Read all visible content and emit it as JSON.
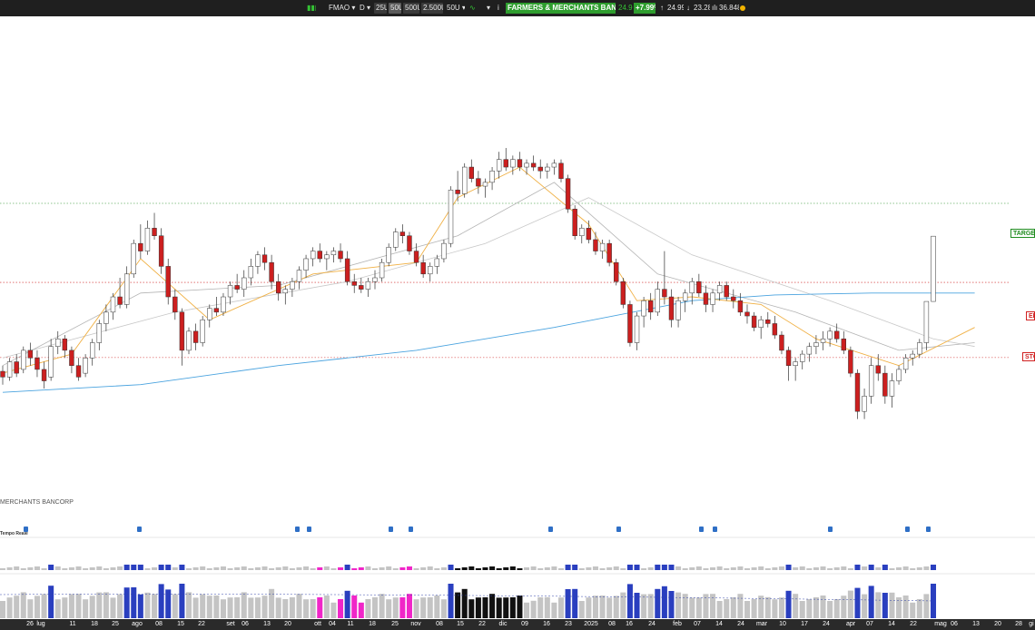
{
  "toolbar": {
    "symbol": "FMAO",
    "interval": "D",
    "chips": [
      "25U",
      "50U",
      "500U",
      "2.500U",
      "50U"
    ],
    "company": "FARMERS & MERCHANTS BANCORP",
    "last": "24.99",
    "change": "+7.99%",
    "high": "24.99",
    "low": "23.28",
    "volume": "36.848"
  },
  "levels": {
    "target": "TARGET",
    "entry": "EN",
    "stop": "STO"
  },
  "company_caption": "MERCHANTS BANCORP",
  "realtime_caption": "Tempo Reale",
  "x_labels": [
    "26",
    "lug",
    "11",
    "18",
    "25",
    "ago",
    "08",
    "15",
    "22",
    "set",
    "06",
    "13",
    "20",
    "ott",
    "04",
    "11",
    "18",
    "25",
    "nov",
    "08",
    "15",
    "22",
    "dic",
    "09",
    "16",
    "23",
    "2025",
    "08",
    "16",
    "24",
    "feb",
    "07",
    "14",
    "24",
    "mar",
    "10",
    "17",
    "24",
    "apr",
    "07",
    "14",
    "22",
    "mag",
    "06",
    "13",
    "20",
    "28",
    "gi"
  ],
  "colors": {
    "up": "#ffffff",
    "down": "#cc1f1f",
    "ma200": "#4aa3df",
    "ma_fast": "#f0b044",
    "target": "#1e8c1e",
    "stop": "#d02020",
    "vol_blue": "#2a3fbf",
    "vol_pink": "#f026c8",
    "vol_black": "#111111"
  },
  "chart_data": {
    "type": "candlestick",
    "x_start": "2024-06-21",
    "x_end": "2025-04-29",
    "ohlc": [
      [
        21.45,
        21.6,
        21.1,
        21.3
      ],
      [
        21.3,
        21.8,
        21.2,
        21.7
      ],
      [
        21.7,
        21.9,
        21.3,
        21.4
      ],
      [
        21.5,
        22.1,
        21.4,
        22.0
      ],
      [
        22.0,
        22.2,
        21.6,
        21.8
      ],
      [
        21.8,
        22.0,
        21.3,
        21.5
      ],
      [
        21.5,
        21.7,
        21.0,
        21.2
      ],
      [
        21.3,
        22.3,
        21.2,
        22.1
      ],
      [
        22.1,
        22.5,
        21.9,
        22.3
      ],
      [
        22.3,
        22.4,
        21.8,
        22.0
      ],
      [
        22.0,
        22.1,
        21.4,
        21.6
      ],
      [
        21.6,
        21.8,
        21.2,
        21.3
      ],
      [
        21.4,
        21.9,
        21.3,
        21.8
      ],
      [
        21.8,
        22.3,
        21.6,
        22.2
      ],
      [
        22.2,
        22.8,
        22.0,
        22.7
      ],
      [
        22.7,
        23.2,
        22.5,
        23.0
      ],
      [
        23.0,
        23.5,
        22.8,
        23.4
      ],
      [
        23.4,
        23.9,
        23.1,
        23.2
      ],
      [
        23.2,
        24.2,
        23.1,
        24.0
      ],
      [
        24.0,
        24.9,
        23.9,
        24.8
      ],
      [
        24.8,
        25.3,
        24.4,
        24.6
      ],
      [
        24.6,
        25.4,
        24.5,
        25.2
      ],
      [
        25.2,
        25.6,
        24.9,
        25.0
      ],
      [
        25.0,
        25.2,
        24.0,
        24.2
      ],
      [
        24.2,
        24.4,
        23.2,
        23.4
      ],
      [
        23.4,
        23.6,
        22.8,
        23.0
      ],
      [
        23.0,
        23.1,
        21.6,
        22.0
      ],
      [
        22.0,
        22.6,
        21.9,
        22.5
      ],
      [
        22.5,
        22.7,
        22.0,
        22.2
      ],
      [
        22.2,
        22.9,
        22.1,
        22.8
      ],
      [
        22.8,
        23.2,
        22.6,
        23.1
      ],
      [
        23.1,
        23.4,
        22.9,
        23.0
      ],
      [
        23.0,
        23.5,
        22.9,
        23.4
      ],
      [
        23.4,
        23.8,
        23.2,
        23.7
      ],
      [
        23.7,
        24.0,
        23.5,
        23.6
      ],
      [
        23.6,
        24.1,
        23.4,
        23.9
      ],
      [
        23.9,
        24.4,
        23.7,
        24.2
      ],
      [
        24.2,
        24.6,
        24.0,
        24.5
      ],
      [
        24.5,
        24.7,
        24.1,
        24.3
      ],
      [
        24.3,
        24.5,
        23.6,
        23.8
      ],
      [
        23.8,
        24.0,
        23.3,
        23.5
      ],
      [
        23.5,
        23.7,
        23.2,
        23.6
      ],
      [
        23.6,
        23.9,
        23.4,
        23.8
      ],
      [
        23.8,
        24.2,
        23.6,
        24.1
      ],
      [
        24.1,
        24.5,
        23.9,
        24.4
      ],
      [
        24.4,
        24.7,
        24.2,
        24.6
      ],
      [
        24.6,
        24.8,
        24.3,
        24.4
      ],
      [
        24.4,
        24.6,
        24.1,
        24.5
      ],
      [
        24.5,
        24.7,
        24.3,
        24.6
      ],
      [
        24.6,
        24.8,
        24.3,
        24.4
      ],
      [
        24.4,
        24.6,
        23.7,
        23.8
      ],
      [
        23.8,
        24.0,
        23.5,
        23.7
      ],
      [
        23.7,
        23.9,
        23.5,
        23.6
      ],
      [
        23.6,
        23.9,
        23.4,
        23.8
      ],
      [
        23.8,
        24.1,
        23.6,
        23.9
      ],
      [
        23.9,
        24.4,
        23.8,
        24.3
      ],
      [
        24.3,
        24.8,
        24.2,
        24.7
      ],
      [
        24.7,
        25.2,
        24.6,
        25.1
      ],
      [
        25.1,
        25.3,
        24.8,
        25.0
      ],
      [
        25.0,
        25.1,
        24.5,
        24.6
      ],
      [
        24.6,
        24.8,
        24.2,
        24.3
      ],
      [
        24.3,
        24.5,
        23.9,
        24.0
      ],
      [
        24.0,
        24.3,
        23.8,
        24.2
      ],
      [
        24.2,
        24.5,
        24.0,
        24.4
      ],
      [
        24.4,
        24.9,
        24.3,
        24.8
      ],
      [
        24.8,
        26.3,
        24.7,
        26.2
      ],
      [
        26.2,
        26.7,
        25.9,
        26.1
      ],
      [
        26.1,
        26.9,
        26.0,
        26.8
      ],
      [
        26.8,
        27.0,
        26.4,
        26.5
      ],
      [
        26.5,
        26.7,
        26.1,
        26.3
      ],
      [
        26.3,
        26.5,
        26.0,
        26.4
      ],
      [
        26.4,
        26.8,
        26.2,
        26.7
      ],
      [
        26.7,
        27.2,
        26.5,
        27.0
      ],
      [
        27.0,
        27.3,
        26.7,
        26.8
      ],
      [
        26.8,
        27.1,
        26.6,
        27.0
      ],
      [
        27.0,
        27.2,
        26.7,
        26.8
      ],
      [
        26.8,
        27.0,
        26.6,
        26.9
      ],
      [
        26.9,
        27.1,
        26.7,
        26.8
      ],
      [
        26.8,
        27.0,
        26.5,
        26.7
      ],
      [
        26.7,
        26.9,
        26.5,
        26.8
      ],
      [
        26.8,
        27.0,
        26.6,
        26.9
      ],
      [
        26.9,
        27.0,
        26.4,
        26.5
      ],
      [
        26.5,
        26.6,
        25.6,
        25.7
      ],
      [
        25.7,
        25.8,
        24.9,
        25.0
      ],
      [
        25.0,
        25.3,
        24.8,
        25.2
      ],
      [
        25.2,
        25.4,
        24.8,
        24.9
      ],
      [
        24.9,
        25.1,
        24.5,
        24.6
      ],
      [
        24.6,
        24.9,
        24.4,
        24.8
      ],
      [
        24.8,
        24.9,
        24.2,
        24.3
      ],
      [
        24.3,
        24.4,
        23.7,
        23.8
      ],
      [
        23.8,
        23.9,
        23.1,
        23.2
      ],
      [
        23.2,
        23.3,
        22.1,
        22.2
      ],
      [
        22.2,
        23.0,
        22.0,
        22.9
      ],
      [
        22.9,
        23.4,
        22.6,
        23.3
      ],
      [
        23.3,
        23.5,
        22.8,
        23.0
      ],
      [
        23.0,
        23.8,
        22.9,
        23.6
      ],
      [
        23.6,
        24.6,
        23.2,
        23.4
      ],
      [
        23.4,
        23.6,
        22.6,
        22.8
      ],
      [
        22.8,
        23.4,
        22.6,
        23.3
      ],
      [
        23.3,
        23.6,
        23.0,
        23.5
      ],
      [
        23.5,
        23.9,
        23.2,
        23.8
      ],
      [
        23.8,
        24.0,
        23.4,
        23.5
      ],
      [
        23.5,
        23.7,
        23.0,
        23.2
      ],
      [
        23.2,
        23.6,
        23.0,
        23.5
      ],
      [
        23.5,
        23.8,
        23.3,
        23.7
      ],
      [
        23.7,
        23.8,
        23.3,
        23.4
      ],
      [
        23.4,
        23.6,
        23.1,
        23.3
      ],
      [
        23.3,
        23.5,
        22.9,
        23.0
      ],
      [
        23.0,
        23.2,
        22.7,
        22.9
      ],
      [
        22.9,
        23.0,
        22.5,
        22.6
      ],
      [
        22.6,
        22.9,
        22.3,
        22.8
      ],
      [
        22.8,
        23.0,
        22.6,
        22.7
      ],
      [
        22.7,
        22.9,
        22.3,
        22.4
      ],
      [
        22.4,
        22.5,
        21.9,
        22.0
      ],
      [
        22.0,
        22.1,
        21.2,
        21.6
      ],
      [
        21.6,
        21.8,
        21.2,
        21.7
      ],
      [
        21.7,
        22.0,
        21.5,
        21.9
      ],
      [
        21.9,
        22.2,
        21.7,
        22.1
      ],
      [
        22.1,
        22.4,
        21.9,
        22.2
      ],
      [
        22.2,
        22.5,
        22.0,
        22.3
      ],
      [
        22.3,
        22.6,
        22.1,
        22.5
      ],
      [
        22.5,
        22.7,
        22.2,
        22.3
      ],
      [
        22.3,
        22.5,
        21.9,
        22.0
      ],
      [
        22.0,
        22.1,
        21.3,
        21.4
      ],
      [
        21.4,
        21.5,
        20.2,
        20.4
      ],
      [
        20.4,
        21.0,
        20.2,
        20.8
      ],
      [
        20.8,
        21.8,
        20.6,
        21.6
      ],
      [
        21.6,
        21.9,
        21.2,
        21.4
      ],
      [
        21.4,
        21.6,
        20.6,
        20.8
      ],
      [
        20.8,
        21.4,
        20.5,
        21.2
      ],
      [
        21.2,
        21.6,
        21.1,
        21.5
      ],
      [
        21.5,
        21.9,
        21.4,
        21.8
      ],
      [
        21.8,
        22.0,
        21.6,
        21.9
      ],
      [
        21.9,
        22.3,
        21.8,
        22.2
      ],
      [
        22.2,
        22.7,
        22.0,
        23.28
      ],
      [
        23.28,
        24.99,
        23.28,
        24.99
      ]
    ],
    "ma200": [
      [
        0,
        20.9
      ],
      [
        20,
        21.1
      ],
      [
        40,
        21.6
      ],
      [
        60,
        22.0
      ],
      [
        80,
        22.6
      ],
      [
        100,
        23.3
      ],
      [
        112,
        23.45
      ],
      [
        126,
        23.5
      ],
      [
        141,
        23.5
      ]
    ],
    "ma_fast": [
      [
        0,
        21.4
      ],
      [
        10,
        21.9
      ],
      [
        20,
        24.4
      ],
      [
        30,
        22.8
      ],
      [
        45,
        24.0
      ],
      [
        60,
        24.3
      ],
      [
        66,
        26.0
      ],
      [
        75,
        26.8
      ],
      [
        85,
        25.3
      ],
      [
        92,
        23.3
      ],
      [
        100,
        23.4
      ],
      [
        110,
        23.2
      ],
      [
        118,
        22.3
      ],
      [
        130,
        21.6
      ],
      [
        141,
        22.6
      ]
    ],
    "ma_mid": [
      [
        0,
        21.6
      ],
      [
        20,
        23.5
      ],
      [
        40,
        23.7
      ],
      [
        66,
        25.0
      ],
      [
        80,
        26.4
      ],
      [
        95,
        24.0
      ],
      [
        115,
        23.0
      ],
      [
        130,
        22.0
      ],
      [
        141,
        22.2
      ]
    ],
    "ma_slow": [
      [
        0,
        21.8
      ],
      [
        25,
        23.0
      ],
      [
        50,
        23.8
      ],
      [
        70,
        24.8
      ],
      [
        85,
        26.0
      ],
      [
        100,
        24.5
      ],
      [
        120,
        23.3
      ],
      [
        135,
        22.3
      ],
      [
        141,
        22.1
      ]
    ],
    "levels": {
      "target": 25.85,
      "entry": 23.78,
      "stop": 21.81
    },
    "y_range": [
      20.0,
      27.8
    ],
    "volume_panel_1": "mixed colour per day",
    "volume_panel_2": "mixed colour per day"
  }
}
